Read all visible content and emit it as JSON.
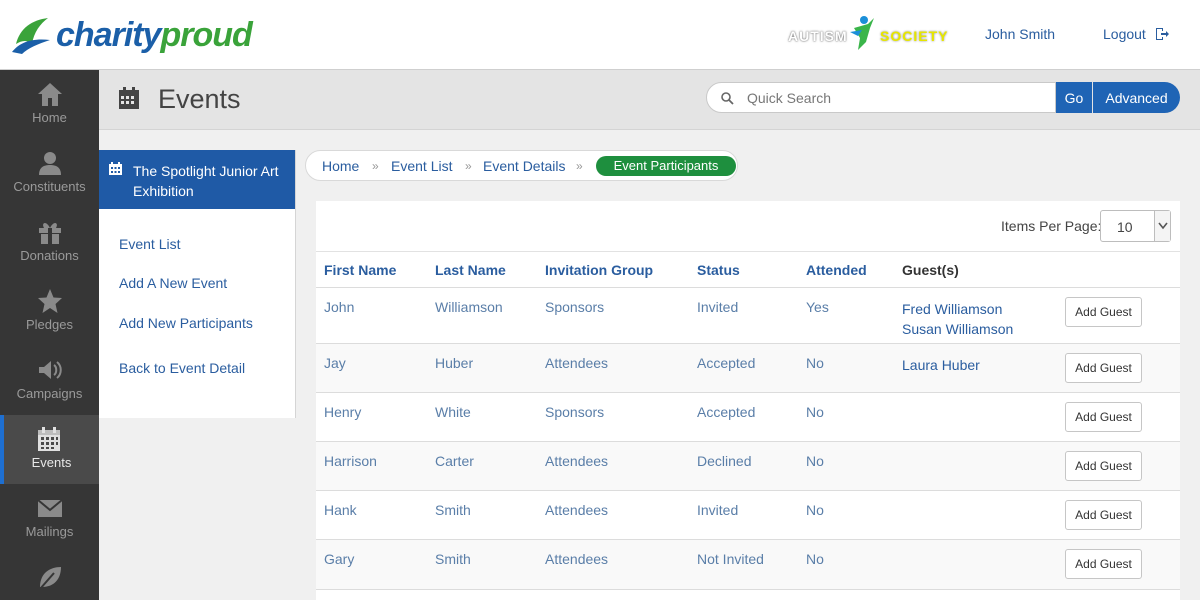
{
  "header": {
    "logo_text_a": "charity",
    "logo_text_b": "proud",
    "org_logo_a": "AUTISM",
    "org_logo_b": "SOCIETY",
    "user_name": "John Smith",
    "logout_label": "Logout",
    "colors": {
      "brand_blue": "#1b5fa8",
      "brand_green": "#3aa33a"
    }
  },
  "sidenav": {
    "items": [
      {
        "label": "Home",
        "icon": "home-icon"
      },
      {
        "label": "Constituents",
        "icon": "person-icon"
      },
      {
        "label": "Donations",
        "icon": "gift-icon"
      },
      {
        "label": "Pledges",
        "icon": "star-icon"
      },
      {
        "label": "Campaigns",
        "icon": "megaphone-icon"
      },
      {
        "label": "Events",
        "icon": "calendar-icon",
        "active": true
      },
      {
        "label": "Mailings",
        "icon": "envelope-icon"
      },
      {
        "label": "",
        "icon": "leaf-icon"
      }
    ]
  },
  "page": {
    "title": "Events",
    "search": {
      "placeholder": "Quick Search",
      "go_label": "Go",
      "advanced_label": "Advanced"
    }
  },
  "subnav": {
    "event_title": "The Spotlight Junior Art Exhibition",
    "links": [
      "Event List",
      "Add A New Event",
      "Add New Participants",
      "Back to Event Detail"
    ]
  },
  "breadcrumb": {
    "items": [
      "Home",
      "Event List",
      "Event Details"
    ],
    "separator": "»",
    "active": "Event Participants"
  },
  "table": {
    "items_per_page_label": "Items Per Page:",
    "items_per_page_value": "10",
    "columns": [
      "First Name",
      "Last Name",
      "Invitation Group",
      "Status",
      "Attended",
      "Guest(s)"
    ],
    "add_guest_label": "Add Guest",
    "rows": [
      {
        "first": "John",
        "last": "Williamson",
        "group": "Sponsors",
        "status": "Invited",
        "attended": "Yes",
        "guests": [
          "Fred Williamson",
          "Susan Williamson"
        ]
      },
      {
        "first": "Jay",
        "last": "Huber",
        "group": "Attendees",
        "status": "Accepted",
        "attended": "No",
        "guests": [
          "Laura Huber"
        ]
      },
      {
        "first": "Henry",
        "last": "White",
        "group": "Sponsors",
        "status": "Accepted",
        "attended": "No",
        "guests": []
      },
      {
        "first": "Harrison",
        "last": "Carter",
        "group": "Attendees",
        "status": "Declined",
        "attended": "No",
        "guests": []
      },
      {
        "first": "Hank",
        "last": "Smith",
        "group": "Attendees",
        "status": "Invited",
        "attended": "No",
        "guests": []
      },
      {
        "first": "Gary",
        "last": "Smith",
        "group": "Attendees",
        "status": "Not Invited",
        "attended": "No",
        "guests": []
      }
    ]
  }
}
